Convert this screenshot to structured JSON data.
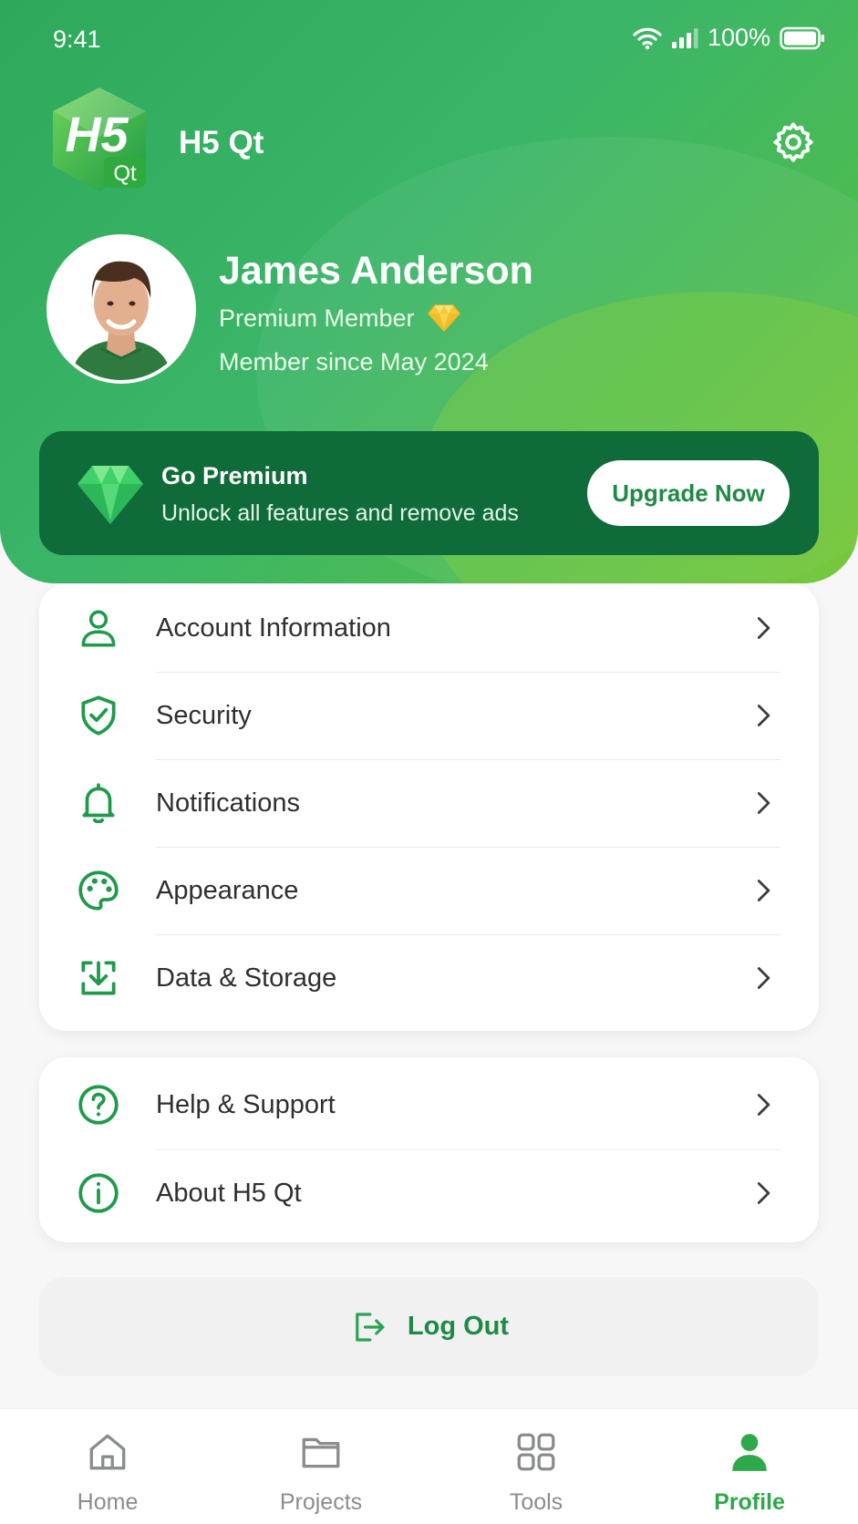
{
  "status_bar": {
    "time": "9:41",
    "battery": "100%"
  },
  "header": {
    "app_name": "H5 Qt",
    "logo_main": "H5",
    "logo_sub": "Qt"
  },
  "profile": {
    "name": "James Anderson",
    "tier": "Premium Member",
    "since": "Member since May 2024"
  },
  "premium": {
    "title": "Go Premium",
    "subtitle": "Unlock all features and remove ads",
    "button": "Upgrade Now"
  },
  "menu_main": [
    {
      "label": "Account Information",
      "icon": "user-icon"
    },
    {
      "label": "Security",
      "icon": "shield-check-icon"
    },
    {
      "label": "Notifications",
      "icon": "bell-icon"
    },
    {
      "label": "Appearance",
      "icon": "palette-icon"
    },
    {
      "label": "Data & Storage",
      "icon": "download-tray-icon"
    }
  ],
  "menu_secondary": [
    {
      "label": "Help & Support",
      "icon": "question-circle-icon"
    },
    {
      "label": "About H5 Qt",
      "icon": "info-circle-icon"
    }
  ],
  "logout": {
    "label": "Log Out"
  },
  "bottom_nav": [
    {
      "label": "Home",
      "icon": "home-icon",
      "active": false
    },
    {
      "label": "Projects",
      "icon": "folder-icon",
      "active": false
    },
    {
      "label": "Tools",
      "icon": "grid-icon",
      "active": false
    },
    {
      "label": "Profile",
      "icon": "person-icon",
      "active": true
    }
  ],
  "colors": {
    "brand_green": "#2ea85a",
    "premium_card": "#106b3a",
    "accent_text": "#1f8a44",
    "icon_green": "#1f9a4a"
  }
}
